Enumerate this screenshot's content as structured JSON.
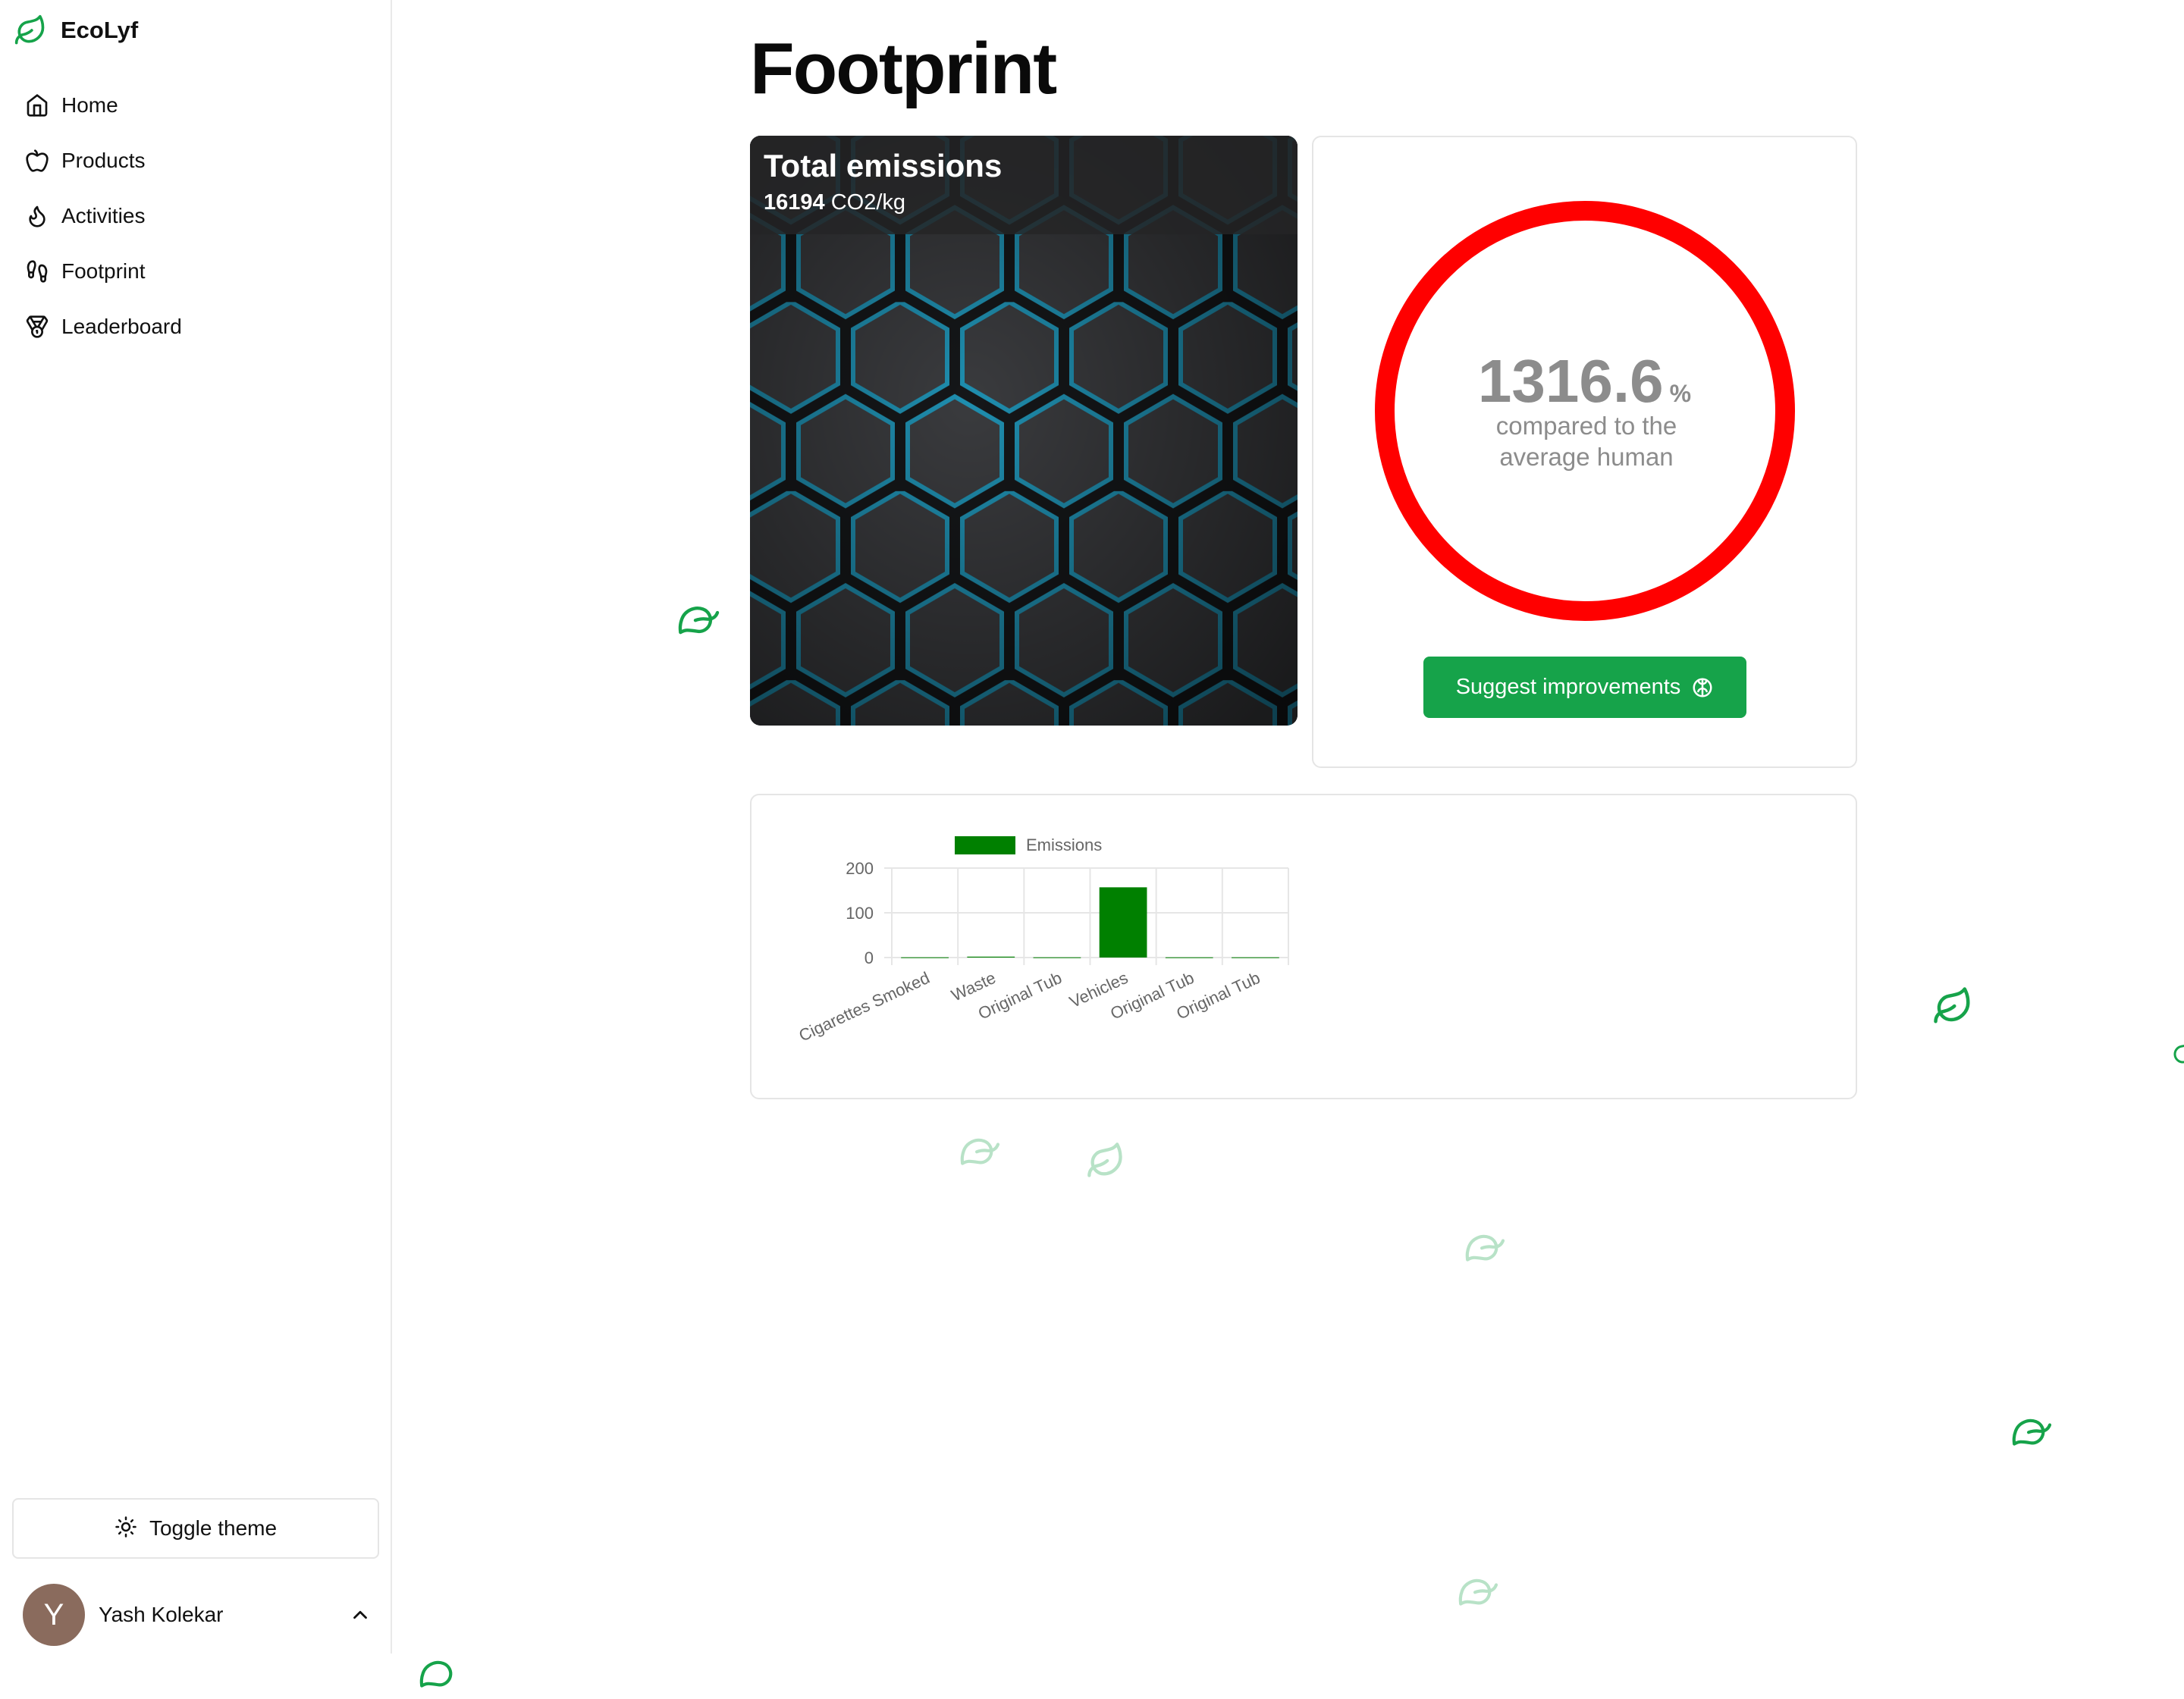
{
  "app": {
    "name": "EcoLyf"
  },
  "sidebar": {
    "items": [
      {
        "label": "Home",
        "icon": "home-icon"
      },
      {
        "label": "Products",
        "icon": "apple-icon"
      },
      {
        "label": "Activities",
        "icon": "flame-icon"
      },
      {
        "label": "Footprint",
        "icon": "footprints-icon"
      },
      {
        "label": "Leaderboard",
        "icon": "medal-icon"
      }
    ],
    "toggle_theme": "Toggle theme",
    "user": {
      "initial": "Y",
      "name": "Yash Kolekar"
    }
  },
  "page": {
    "title": "Footprint"
  },
  "emissions": {
    "title": "Total emissions",
    "value": "16194",
    "unit": "CO2/kg"
  },
  "comparison": {
    "value": "1316.6",
    "unit": "%",
    "caption": "compared to the average human",
    "button": "Suggest improvements",
    "ring_color": "#ff0000"
  },
  "colors": {
    "accent": "#16a34a",
    "bar": "#008000",
    "ring": "#ff0000",
    "leaf": "#16a34a"
  },
  "chart_data": {
    "type": "bar",
    "categories": [
      "Cigarettes Smoked",
      "Waste",
      "Original Tub",
      "Vehicles",
      "Original Tub",
      "Original Tub"
    ],
    "series": [
      {
        "name": "Emissions",
        "values": [
          0.5,
          2,
          0.5,
          157,
          0.5,
          0.5
        ]
      }
    ],
    "ylim": [
      0,
      200
    ],
    "yticks": [
      "0",
      "100",
      "200"
    ],
    "legend": "top",
    "grid": true
  }
}
